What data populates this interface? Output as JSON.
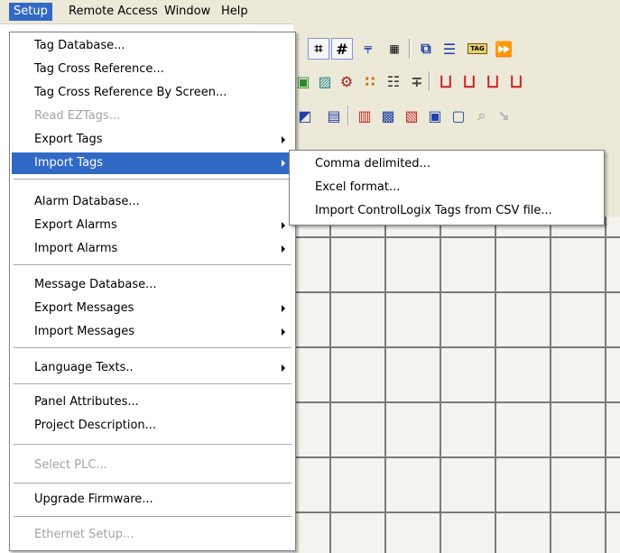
{
  "menubar": {
    "items": [
      {
        "label": "Setup",
        "active": true
      },
      {
        "label": "Remote Access"
      },
      {
        "label": "Window"
      },
      {
        "label": "Help"
      }
    ]
  },
  "setup_menu": {
    "items": [
      {
        "label": "Tag Database...",
        "enabled": true
      },
      {
        "label": "Tag Cross Reference...",
        "enabled": true
      },
      {
        "label": "Tag Cross Reference By Screen...",
        "enabled": true
      },
      {
        "label": "Read EZTags...",
        "enabled": false
      },
      {
        "label": "Export Tags",
        "enabled": true,
        "submenu": true
      },
      {
        "label": "Import Tags",
        "enabled": true,
        "submenu": true,
        "highlighted": true
      },
      {
        "label": "Alarm Database...",
        "enabled": true
      },
      {
        "label": "Export Alarms",
        "enabled": true,
        "submenu": true
      },
      {
        "label": "Import Alarms",
        "enabled": true,
        "submenu": true
      },
      {
        "label": "Message Database...",
        "enabled": true
      },
      {
        "label": "Export Messages",
        "enabled": true,
        "submenu": true
      },
      {
        "label": "Import Messages",
        "enabled": true,
        "submenu": true
      },
      {
        "label": "Language Texts..",
        "enabled": true,
        "submenu": true
      },
      {
        "label": "Panel Attributes...",
        "enabled": true
      },
      {
        "label": "Project Description...",
        "enabled": true
      },
      {
        "label": "Select PLC...",
        "enabled": false
      },
      {
        "label": "Upgrade Firmware...",
        "enabled": true
      },
      {
        "label": "Ethernet Setup...",
        "enabled": false
      }
    ]
  },
  "import_tags_submenu": {
    "items": [
      {
        "label": "Comma delimited..."
      },
      {
        "label": "Excel format..."
      },
      {
        "label": "Import ControlLogix Tags from CSV file..."
      }
    ]
  },
  "toolbar_icons": {
    "grid_icon": "#",
    "tag_icon": "TAG"
  },
  "colors": {
    "highlight": "#316ac5",
    "menu_bg": "#ffffff",
    "chrome_bg": "#ece9d8"
  }
}
